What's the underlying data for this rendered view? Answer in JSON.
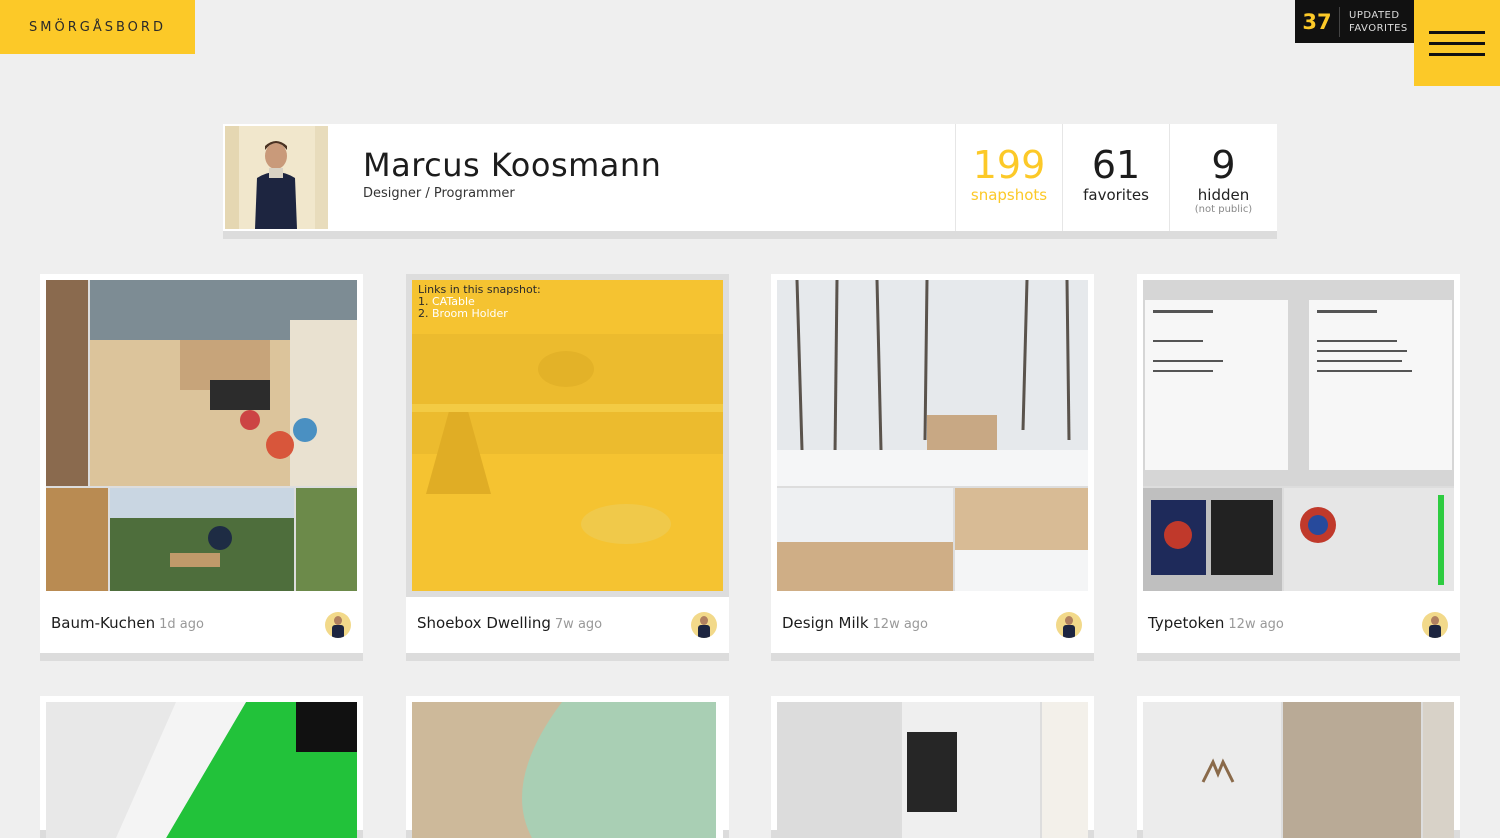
{
  "header": {
    "logo": "SMÖRGÅSBORD",
    "updated_count": "37",
    "updated_line1": "UPDATED",
    "updated_line2": "FAVORITES"
  },
  "profile": {
    "name": "Marcus Koosmann",
    "role": "Designer / Programmer",
    "stats": [
      {
        "num": "199",
        "label": "snapshots",
        "sub": ""
      },
      {
        "num": "61",
        "label": "favorites",
        "sub": ""
      },
      {
        "num": "9",
        "label": "hidden",
        "sub": "(not public)"
      }
    ]
  },
  "snapshots": [
    {
      "title": "Baum-Kuchen",
      "ago": "1d ago"
    },
    {
      "title": "Shoebox Dwelling",
      "ago": "7w ago",
      "links_heading": "Links in this snapshot:",
      "links": [
        "CATable",
        "Broom Holder"
      ]
    },
    {
      "title": "Design Milk",
      "ago": "12w ago"
    },
    {
      "title": "Typetoken",
      "ago": "12w ago"
    }
  ],
  "colors": {
    "accent": "#fcc928",
    "dark": "#111111",
    "background": "#efefef"
  }
}
